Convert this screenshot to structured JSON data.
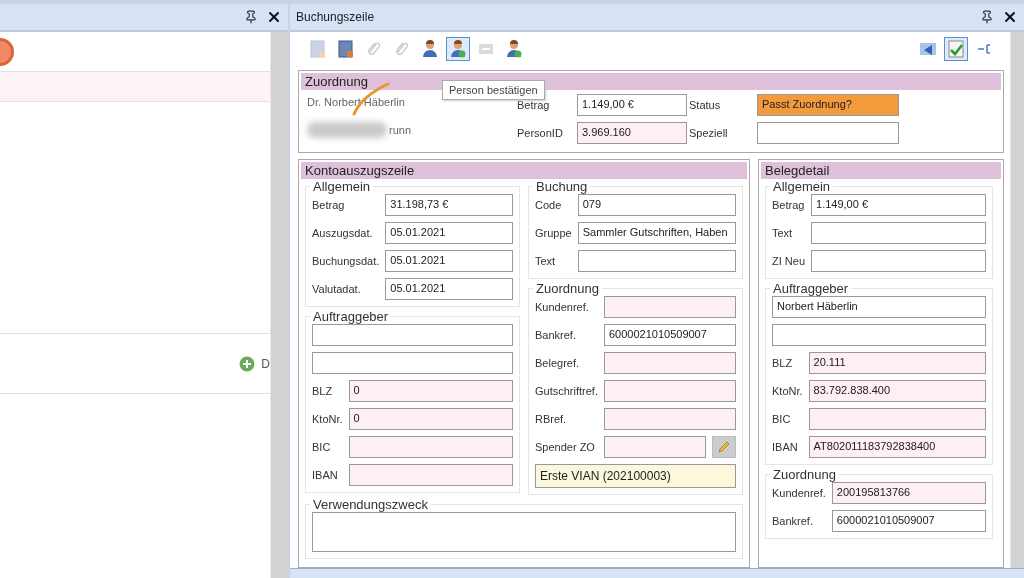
{
  "left_pane": {
    "add_link": "D"
  },
  "window": {
    "title": "Buchungszeile"
  },
  "toolbar": [
    {
      "kind": "document",
      "disabled": true,
      "selected": false
    },
    {
      "kind": "document",
      "disabled": false,
      "selected": false
    },
    {
      "kind": "clip",
      "disabled": true,
      "selected": false
    },
    {
      "kind": "clip",
      "disabled": true,
      "selected": false
    },
    {
      "kind": "person",
      "disabled": false,
      "selected": false
    },
    {
      "kind": "person-check",
      "disabled": false,
      "selected": true
    },
    {
      "kind": "transfer",
      "disabled": true,
      "selected": false
    },
    {
      "kind": "person-add",
      "disabled": false,
      "selected": false
    }
  ],
  "toolbar_right": [
    {
      "kind": "share",
      "disabled": false,
      "selected": false
    },
    {
      "kind": "approve",
      "disabled": false,
      "selected": true
    },
    {
      "kind": "collapse",
      "disabled": false,
      "selected": false
    }
  ],
  "tooltip": "Person bestätigen",
  "zuordnung": {
    "title": "Zuordnung",
    "name": "Dr. Norbert Häberlin",
    "address": "runn",
    "fields": [
      {
        "label": "Betrag",
        "value": "1.149,00 €",
        "readonly": false,
        "highlighted": false
      },
      {
        "label": "Status",
        "value": "Passt Zuordnung?",
        "readonly": false,
        "highlighted": true
      },
      {
        "label": "PersonID",
        "value": "3.969.160",
        "readonly": true,
        "highlighted": false
      },
      {
        "label": "Speziell",
        "readonly": false,
        "highlighted": false
      }
    ]
  },
  "kontoauszugszeile": {
    "title": "Kontoauszugszeile",
    "left_groups": [
      {
        "title": "Allgemein",
        "fields": [
          {
            "label": "Betrag",
            "value": "31.198,73 €",
            "readonly": false
          },
          {
            "label": "Auszugsdat.",
            "value": "05.01.2021",
            "readonly": false
          },
          {
            "label": "Buchungsdat.",
            "value": "05.01.2021",
            "readonly": false
          },
          {
            "label": "Valutadat.",
            "value": "05.01.2021",
            "readonly": false
          }
        ]
      },
      {
        "title": "Auftraggeber",
        "fields": [
          {
            "readonly": false
          },
          {
            "readonly": false
          },
          {
            "label": "BLZ",
            "value": "0",
            "readonly": true
          },
          {
            "label": "KtoNr.",
            "value": "0",
            "readonly": true
          },
          {
            "label": "BIC",
            "readonly": true
          },
          {
            "label": "IBAN",
            "readonly": true
          }
        ]
      }
    ],
    "right_groups": [
      {
        "title": "Buchung",
        "fields": [
          {
            "label": "Code",
            "value": "079",
            "readonly": false
          },
          {
            "label": "Gruppe",
            "value": "Sammler Gutschriften, Haben",
            "readonly": false
          },
          {
            "label": "Text",
            "readonly": false
          }
        ]
      },
      {
        "title": "Zuordnung",
        "fields": [
          {
            "label": "Kundenref.",
            "readonly": true
          },
          {
            "label": "Bankref.",
            "value": "6000021010509007",
            "readonly": false
          },
          {
            "label": "Belegref.",
            "readonly": true
          },
          {
            "label": "Gutschriftref.",
            "readonly": true
          },
          {
            "label": "RBref.",
            "readonly": true
          },
          {
            "label": "Spender ZO",
            "readonly": true,
            "editable": true
          }
        ],
        "note": "Erste VIAN (202100003)"
      }
    ],
    "purpose": {
      "title": "Verwendungszweck"
    }
  },
  "belegdetail": {
    "title": "Belegdetail",
    "groups": [
      {
        "title": "Allgemein",
        "fields": [
          {
            "label": "Betrag",
            "value": "1.149,00 €",
            "readonly": false
          },
          {
            "label": "Text",
            "readonly": false
          },
          {
            "label": "ZI Neu",
            "readonly": false
          }
        ]
      },
      {
        "title": "Auftraggeber",
        "fields": [
          {
            "value": "Norbert Häberlin",
            "readonly": false
          },
          {
            "readonly": false
          },
          {
            "label": "BLZ",
            "value": "20.111",
            "readonly": true
          },
          {
            "label": "KtoNr.",
            "value": "83.792.838.400",
            "readonly": true
          },
          {
            "label": "BIC",
            "readonly": true
          },
          {
            "label": "IBAN",
            "value": "AT802011183792838400",
            "readonly": true
          }
        ]
      },
      {
        "title": "Zuordnung",
        "fields": [
          {
            "label": "Kundenref.",
            "value": "200195813766",
            "readonly": true
          },
          {
            "label": "Bankref.",
            "value": "6000021010509007",
            "readonly": false
          }
        ]
      }
    ]
  }
}
